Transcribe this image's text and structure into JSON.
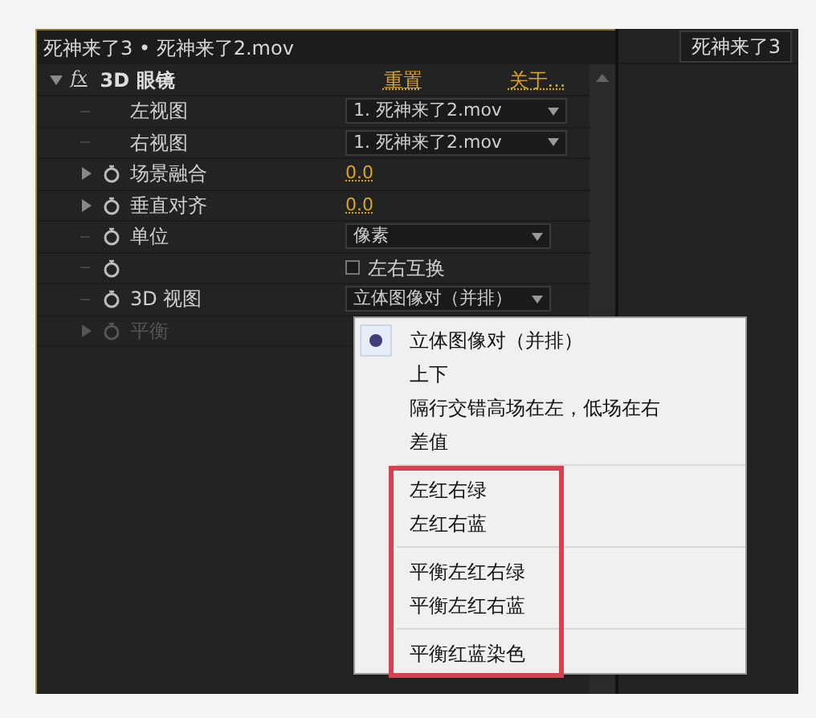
{
  "panel_tab": {
    "title": "死神来了3 • 死神来了2.mov"
  },
  "viewer_tab": {
    "title": "死神来了3"
  },
  "effect": {
    "icon_text": "fx",
    "name": "3D 眼镜",
    "expanded": true,
    "reset": "重置",
    "about": "关于..."
  },
  "properties": [
    {
      "kind": "dropdown",
      "label": "左视图",
      "value": "1. 死神来了2.mov",
      "stopwatch": false,
      "expandable": false,
      "disabled": false
    },
    {
      "kind": "dropdown",
      "label": "右视图",
      "value": "1. 死神来了2.mov",
      "stopwatch": false,
      "expandable": false,
      "disabled": false
    },
    {
      "kind": "number",
      "label": "场景融合",
      "value": "0.0",
      "stopwatch": true,
      "expandable": true,
      "disabled": false
    },
    {
      "kind": "number",
      "label": "垂直对齐",
      "value": "0.0",
      "stopwatch": true,
      "expandable": true,
      "disabled": false
    },
    {
      "kind": "dropdown",
      "label": "单位",
      "value": "像素",
      "stopwatch": true,
      "expandable": false,
      "disabled": false
    },
    {
      "kind": "checkbox",
      "value": "左右互换",
      "checked": false,
      "stopwatch": true,
      "expandable": false,
      "disabled": false
    },
    {
      "kind": "dropdown",
      "label": "3D 视图",
      "value": "立体图像对（并排）",
      "stopwatch": true,
      "expandable": false,
      "disabled": false
    },
    {
      "kind": "none",
      "label": "平衡",
      "stopwatch": true,
      "expandable": true,
      "disabled": true
    }
  ],
  "menu": {
    "groups": [
      {
        "items": [
          {
            "label": "立体图像对（并排）",
            "selected": true
          },
          {
            "label": "上下",
            "selected": false
          },
          {
            "label": "隔行交错高场在左，低场在右",
            "selected": false
          },
          {
            "label": "差值",
            "selected": false
          }
        ]
      },
      {
        "items": [
          {
            "label": "左红右绿",
            "selected": false
          },
          {
            "label": "左红右蓝",
            "selected": false
          }
        ]
      },
      {
        "items": [
          {
            "label": "平衡左红右绿",
            "selected": false
          },
          {
            "label": "平衡左红右蓝",
            "selected": false
          }
        ]
      },
      {
        "items": [
          {
            "label": "平衡红蓝染色",
            "selected": false
          }
        ]
      }
    ]
  }
}
